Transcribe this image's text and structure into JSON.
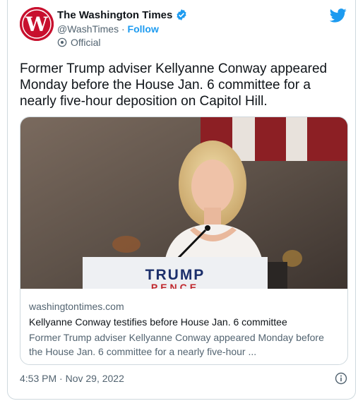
{
  "author": {
    "name": "The Washington Times",
    "handle": "@WashTimes",
    "separator": "·",
    "follow_label": "Follow",
    "label": "Official",
    "avatar_letter": "W"
  },
  "icons": {
    "verified": "verified-badge-icon",
    "bird": "twitter-bird-icon",
    "official": "official-shield-icon",
    "info": "info-icon"
  },
  "colors": {
    "brand": "#1d9bf0",
    "avatar_bg": "#c8102e"
  },
  "tweet": {
    "text": "Former Trump adviser Kellyanne Conway appeared Monday before the House Jan. 6 committee for a nearly five-hour deposition on Capitol Hill."
  },
  "link_card": {
    "podium_line1": "TRUMP",
    "podium_line2": "PENCE",
    "domain": "washingtontimes.com",
    "headline": "Kellyanne Conway testifies before House Jan. 6 committee",
    "description": "Former Trump adviser Kellyanne Conway appeared Monday before the House Jan. 6 committee for a nearly five-hour ..."
  },
  "timestamp": "4:53 PM · Nov 29, 2022"
}
